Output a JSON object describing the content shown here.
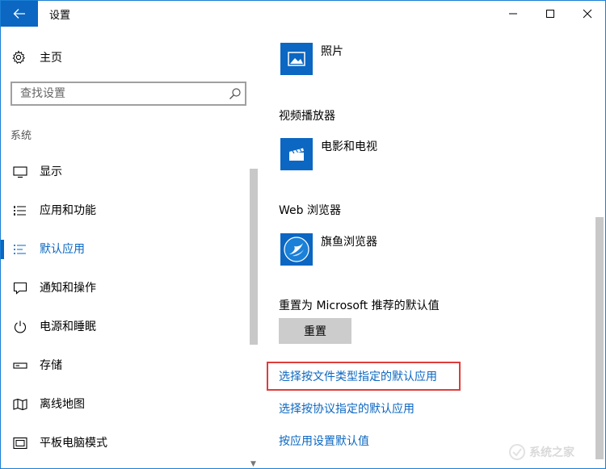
{
  "window": {
    "title": "设置"
  },
  "sidebar": {
    "home_label": "主页",
    "search_placeholder": "查找设置",
    "section_label": "系统",
    "items": [
      {
        "label": "显示",
        "icon": "monitor-icon"
      },
      {
        "label": "应用和功能",
        "icon": "apps-list-icon"
      },
      {
        "label": "默认应用",
        "icon": "default-apps-icon",
        "active": true
      },
      {
        "label": "通知和操作",
        "icon": "notification-icon"
      },
      {
        "label": "电源和睡眠",
        "icon": "power-icon"
      },
      {
        "label": "存储",
        "icon": "storage-icon"
      },
      {
        "label": "离线地图",
        "icon": "map-icon"
      },
      {
        "label": "平板电脑模式",
        "icon": "tablet-icon"
      }
    ]
  },
  "content": {
    "photo_app": "照片",
    "video_category": "视频播放器",
    "video_app": "电影和电视",
    "browser_category": "Web 浏览器",
    "browser_app": "旗鱼浏览器",
    "reset_label": "重置为 Microsoft 推荐的默认值",
    "reset_button": "重置",
    "links": [
      "选择按文件类型指定的默认应用",
      "选择按协议指定的默认应用",
      "按应用设置默认值"
    ]
  },
  "watermark": {
    "text": "系统之家"
  },
  "colors": {
    "accent": "#0b67c2",
    "highlight_border": "#e03c3c",
    "button_bg": "#cccccc"
  }
}
